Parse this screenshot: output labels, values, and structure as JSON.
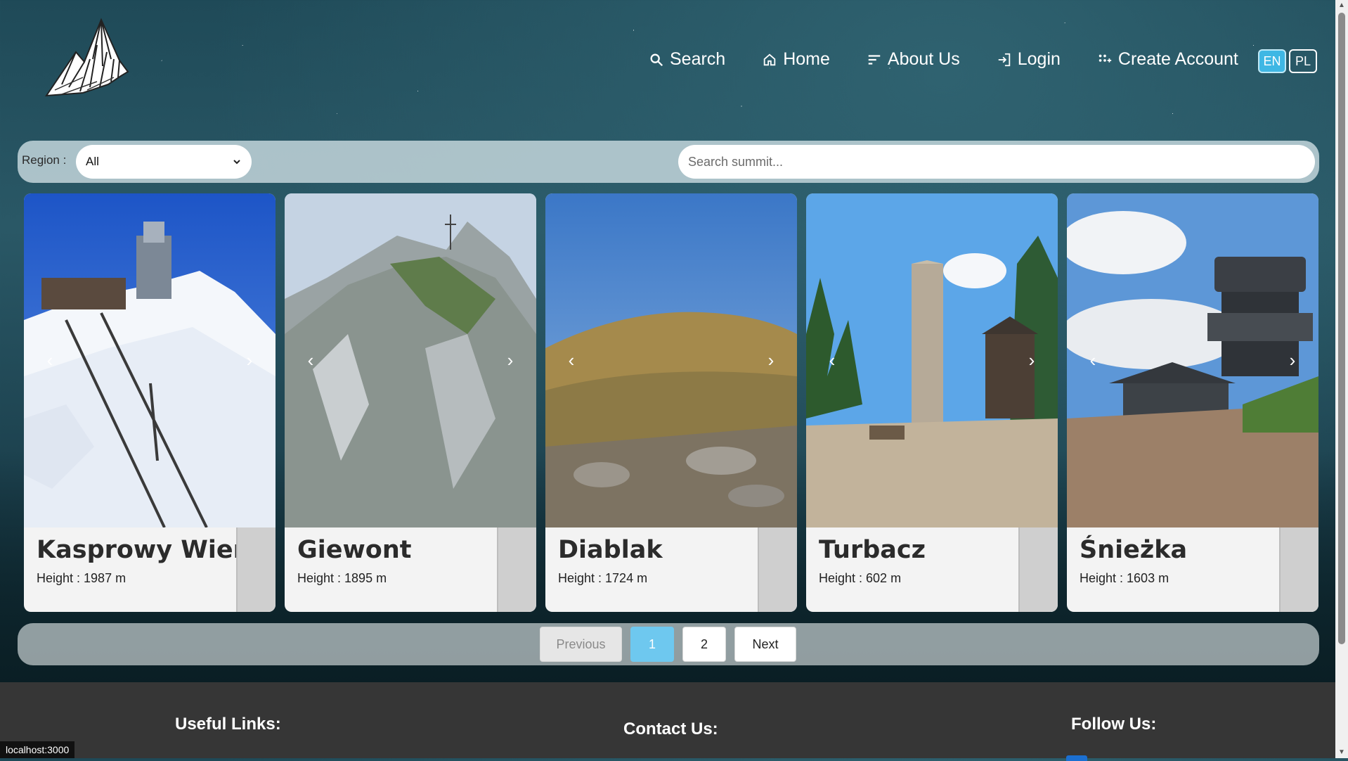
{
  "nav": {
    "items": [
      {
        "label": "Search",
        "icon": "search-icon"
      },
      {
        "label": "Home",
        "icon": "home-icon"
      },
      {
        "label": "About Us",
        "icon": "list-icon"
      },
      {
        "label": "Login",
        "icon": "login-icon"
      },
      {
        "label": "Create Account",
        "icon": "user-plus-icon"
      }
    ]
  },
  "lang": {
    "en": "EN",
    "pl": "PL",
    "active": "EN"
  },
  "filter": {
    "region_label": "Region :",
    "region_value": "All",
    "search_placeholder": "Search summit..."
  },
  "cards": [
    {
      "title": "Kasprowy Wierch",
      "height": "Height : 1987 m"
    },
    {
      "title": "Giewont",
      "height": "Height : 1895 m"
    },
    {
      "title": "Diablak",
      "height": "Height : 1724 m"
    },
    {
      "title": "Turbacz",
      "height": "Height : 602 m"
    },
    {
      "title": "Śnieżka",
      "height": "Height : 1603 m"
    }
  ],
  "pager": {
    "previous": "Previous",
    "pages": [
      "1",
      "2"
    ],
    "active": "1",
    "next": "Next"
  },
  "footer": {
    "useful_links": "Useful Links:",
    "contact": "Contact Us:",
    "follow": "Follow Us:"
  },
  "status_url": "localhost:3000",
  "colors": {
    "accent": "#3fb7e4",
    "active_page": "#6ec8ef",
    "footer": "#363636"
  }
}
